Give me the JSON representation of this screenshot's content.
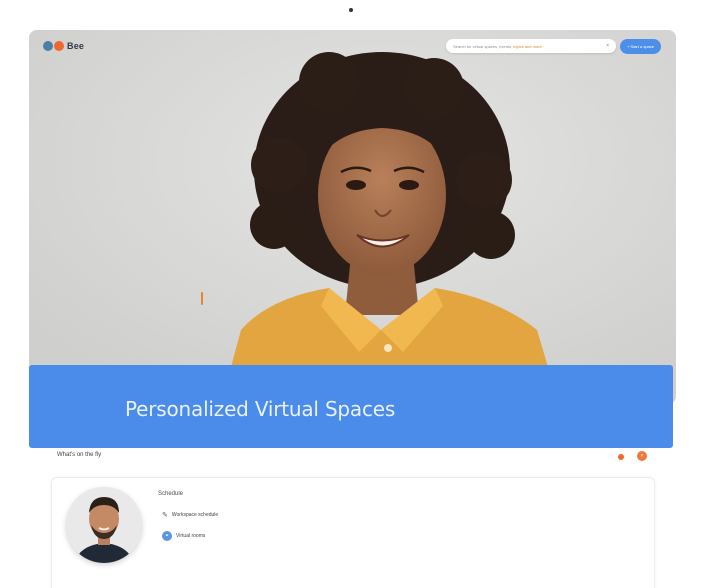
{
  "header": {
    "logo_text": "Bee",
    "search_placeholder": "Search for virtual spaces, events,",
    "search_highlight": "topics and more",
    "search_clear": "×",
    "cta_label": "+ Start a space"
  },
  "banner": {
    "title": "Personalized Virtual Spaces"
  },
  "subheader": {
    "title": "What's on the fly",
    "badge_icon": "close-icon"
  },
  "profile_card": {
    "section_label": "Schedule",
    "rows": [
      {
        "icon": "pencil-icon",
        "text": "Workspace schedule"
      },
      {
        "icon": "link-icon",
        "text": "Virtual rooms"
      }
    ]
  },
  "colors": {
    "accent_blue": "#4b8bea",
    "accent_orange": "#ee6a2c"
  }
}
